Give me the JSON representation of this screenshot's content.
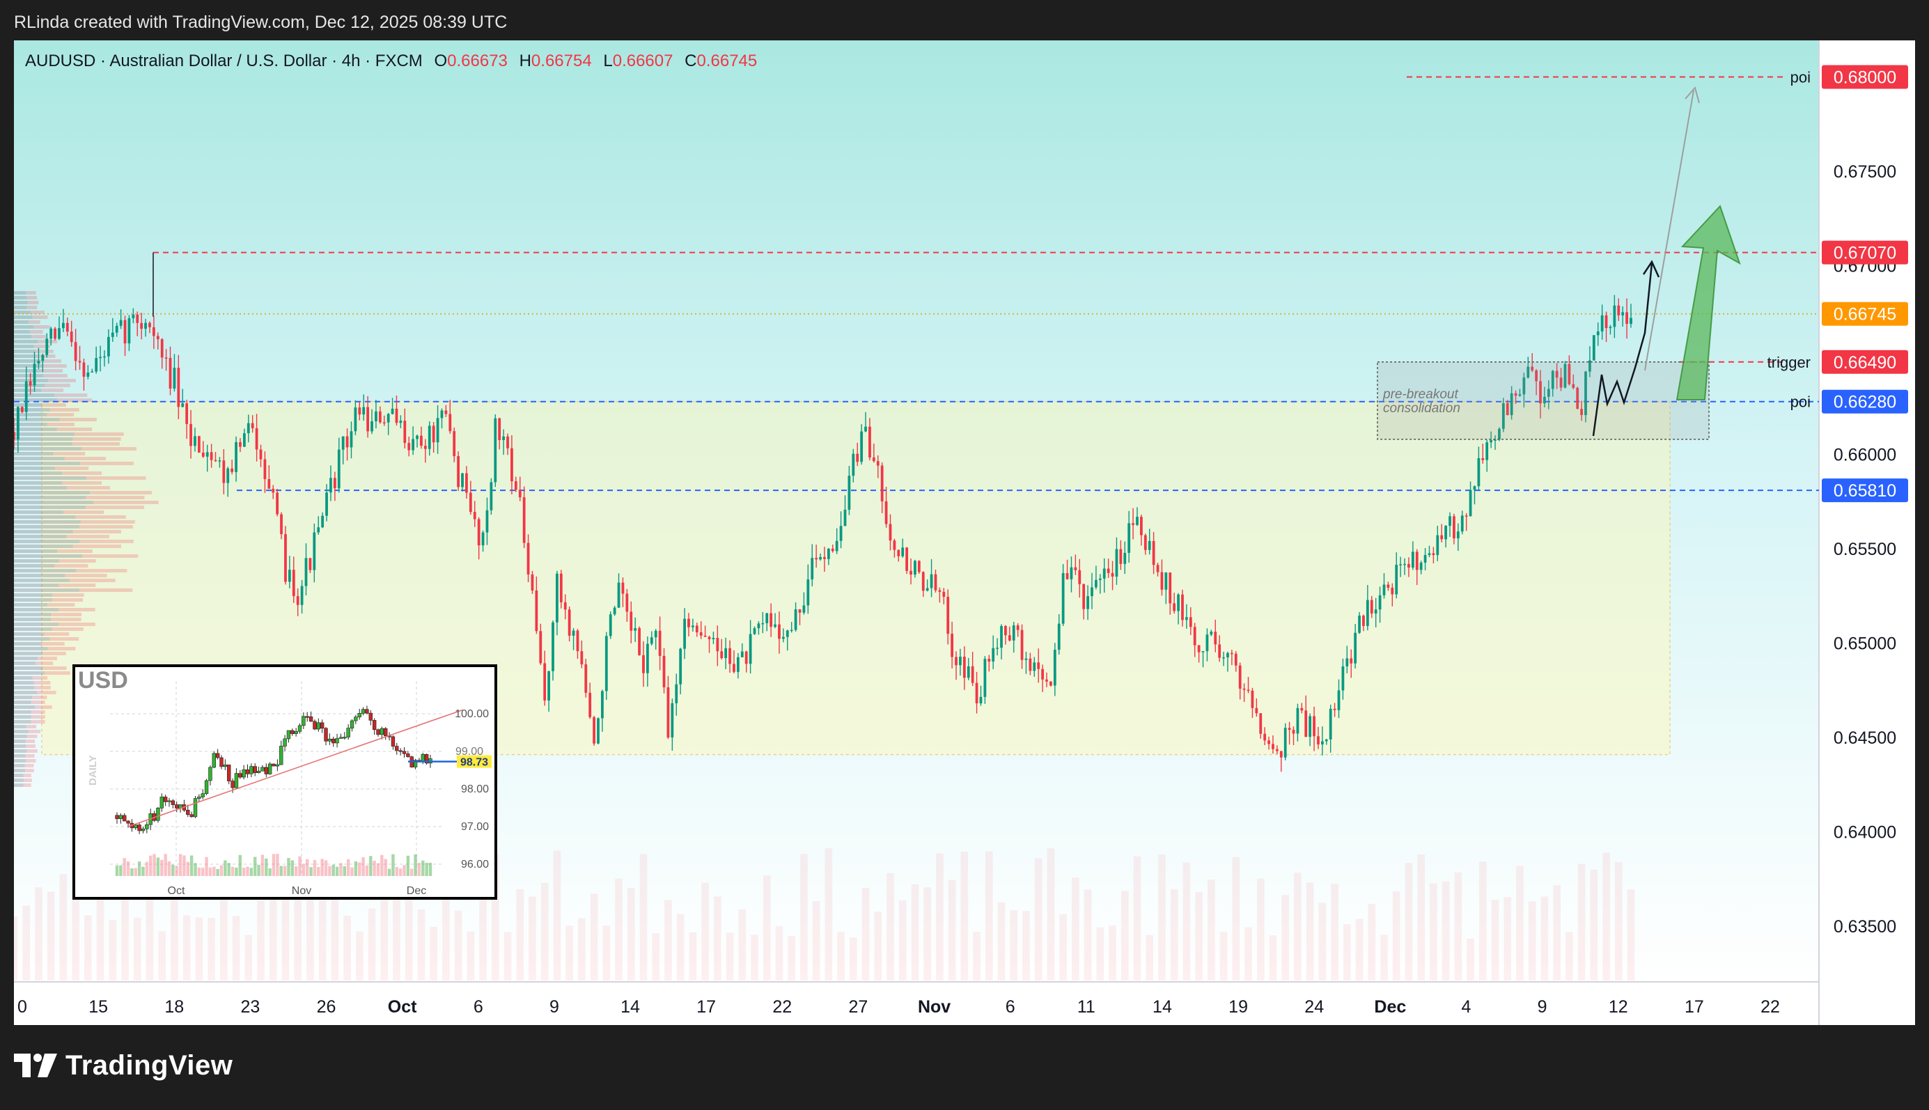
{
  "header": {
    "attribution": "RLinda created with TradingView.com, Dec 12, 2025 08:39 UTC"
  },
  "legend": {
    "symbol": "AUDUSD · Australian Dollar / U.S. Dollar · 4h · FXCM",
    "open_label": "O",
    "open": "0.66673",
    "high_label": "H",
    "high": "0.66754",
    "low_label": "L",
    "low": "0.66607",
    "close_label": "C",
    "close": "0.66745"
  },
  "footer": {
    "brand": "TradingView"
  },
  "colors": {
    "up": "#089981",
    "down": "#f23645",
    "red_level": "#f23645",
    "blue_level": "#2962ff",
    "orange_level": "#ff9800",
    "arrow_green": "#5cb85c"
  },
  "chart_data": [
    {
      "type": "candlestick",
      "title": "AUDUSD · Australian Dollar / U.S. Dollar · 4h · FXCM",
      "x_tick_labels": [
        "0",
        "15",
        "18",
        "23",
        "26",
        "Oct",
        "6",
        "9",
        "14",
        "17",
        "22",
        "27",
        "Nov",
        "6",
        "11",
        "14",
        "19",
        "24",
        "Dec",
        "4",
        "9",
        "12",
        "17",
        "22"
      ],
      "y_tick_labels": [
        "0.67500",
        "0.67000",
        "0.66000",
        "0.65500",
        "0.65000",
        "0.64500",
        "0.64000",
        "0.63500"
      ],
      "y_ticks": [
        0.675,
        0.67,
        0.66,
        0.655,
        0.65,
        0.645,
        0.64,
        0.635
      ],
      "ylim": [
        0.6325,
        0.6812
      ],
      "close_path": [
        [
          0,
          0.6612
        ],
        [
          2,
          0.665
        ],
        [
          4,
          0.6668
        ],
        [
          6,
          0.6642
        ],
        [
          8,
          0.666
        ],
        [
          10,
          0.6672
        ],
        [
          11,
          0.667
        ],
        [
          12,
          0.665
        ],
        [
          13,
          0.6638
        ],
        [
          14,
          0.661
        ],
        [
          16,
          0.6602
        ],
        [
          17,
          0.659
        ],
        [
          19,
          0.6612
        ],
        [
          20,
          0.6605
        ],
        [
          21,
          0.6572
        ],
        [
          22,
          0.654
        ],
        [
          23,
          0.6528
        ],
        [
          24,
          0.6545
        ],
        [
          25,
          0.6565
        ],
        [
          26,
          0.659
        ],
        [
          27,
          0.6608
        ],
        [
          28,
          0.6625
        ],
        [
          29,
          0.6615
        ],
        [
          30,
          0.662
        ],
        [
          32,
          0.661
        ],
        [
          33,
          0.6605
        ],
        [
          35,
          0.6618
        ],
        [
          36,
          0.659
        ],
        [
          37,
          0.6568
        ],
        [
          38,
          0.6555
        ],
        [
          39,
          0.6612
        ],
        [
          40,
          0.6605
        ],
        [
          41,
          0.657
        ],
        [
          42,
          0.652
        ],
        [
          43,
          0.647
        ],
        [
          44,
          0.653
        ],
        [
          46,
          0.649
        ],
        [
          47,
          0.6442
        ],
        [
          48,
          0.65
        ],
        [
          49,
          0.6525
        ],
        [
          50,
          0.6505
        ],
        [
          51,
          0.649
        ],
        [
          52,
          0.6508
        ],
        [
          53,
          0.645
        ],
        [
          54,
          0.65
        ],
        [
          55,
          0.6515
        ],
        [
          56,
          0.6505
        ],
        [
          57,
          0.6495
        ],
        [
          59,
          0.649
        ],
        [
          61,
          0.6512
        ],
        [
          63,
          0.6505
        ],
        [
          65,
          0.6545
        ],
        [
          67,
          0.656
        ],
        [
          68,
          0.6598
        ],
        [
          69,
          0.6608
        ],
        [
          70,
          0.6592
        ],
        [
          71,
          0.656
        ],
        [
          72,
          0.6545
        ],
        [
          73,
          0.6538
        ],
        [
          75,
          0.6525
        ],
        [
          76,
          0.65
        ],
        [
          77,
          0.6488
        ],
        [
          78,
          0.647
        ],
        [
          80,
          0.6512
        ],
        [
          81,
          0.6505
        ],
        [
          82,
          0.649
        ],
        [
          84,
          0.648
        ],
        [
          85,
          0.6532
        ],
        [
          86,
          0.6538
        ],
        [
          87,
          0.652
        ],
        [
          89,
          0.654
        ],
        [
          90,
          0.6555
        ],
        [
          91,
          0.6572
        ],
        [
          92,
          0.655
        ],
        [
          93,
          0.6535
        ],
        [
          95,
          0.651
        ],
        [
          96,
          0.6495
        ],
        [
          97,
          0.6505
        ],
        [
          99,
          0.6485
        ],
        [
          100,
          0.6475
        ],
        [
          101,
          0.646
        ],
        [
          102,
          0.644
        ],
        [
          103,
          0.645
        ],
        [
          104,
          0.6462
        ],
        [
          105,
          0.6455
        ],
        [
          106,
          0.645
        ],
        [
          107,
          0.6465
        ],
        [
          108,
          0.649
        ],
        [
          109,
          0.6508
        ],
        [
          110,
          0.6522
        ],
        [
          111,
          0.653
        ],
        [
          112,
          0.6535
        ],
        [
          113,
          0.654
        ],
        [
          114,
          0.655
        ],
        [
          115,
          0.6545
        ],
        [
          116,
          0.6558
        ],
        [
          117,
          0.6565
        ],
        [
          118,
          0.658
        ],
        [
          119,
          0.66
        ],
        [
          120,
          0.6612
        ],
        [
          121,
          0.6625
        ],
        [
          122,
          0.6635
        ],
        [
          123,
          0.6642
        ],
        [
          124,
          0.663
        ],
        [
          125,
          0.6645
        ],
        [
          126,
          0.6638
        ],
        [
          127,
          0.6625
        ],
        [
          128,
          0.666
        ],
        [
          129,
          0.667
        ],
        [
          130,
          0.6672
        ],
        [
          131,
          0.6674
        ]
      ],
      "levels": [
        {
          "label": "poi",
          "value": "0.68000",
          "price": 0.68,
          "style": "red-dashed"
        },
        {
          "label": "",
          "value": "0.67070",
          "price": 0.6707,
          "style": "red-dashed"
        },
        {
          "label": "",
          "value": "0.66745",
          "price": 0.66745,
          "style": "orange-dotted"
        },
        {
          "label": "trigger",
          "value": "0.66490",
          "price": 0.6649,
          "style": "red-dashed"
        },
        {
          "label": "poi",
          "value": "0.66280",
          "price": 0.6628,
          "style": "blue-dashed"
        },
        {
          "label": "",
          "value": "0.65810",
          "price": 0.6581,
          "style": "blue-dashed"
        }
      ],
      "range_zone": {
        "top": 0.6628,
        "bottom": 0.6441
      },
      "consolidation_box": {
        "top": 0.6649,
        "bottom": 0.6608,
        "label_line1": "pre-breakout",
        "label_line2": "consolidation"
      },
      "volume_profile": "left",
      "grid": false
    },
    {
      "type": "candlestick",
      "title": "USD",
      "side_label": "DAILY",
      "x_tick_labels": [
        "Oct",
        "Nov",
        "Dec"
      ],
      "y_tick_labels": [
        "100.00",
        "99.00",
        "98.00",
        "97.00",
        "96.00"
      ],
      "y_ticks": [
        100,
        99,
        98,
        97,
        96
      ],
      "ylim": [
        95.5,
        100.5
      ],
      "last_price": "98.73",
      "last_price_value": 98.73,
      "close_path": [
        [
          0,
          97.3
        ],
        [
          3,
          97.0
        ],
        [
          5,
          96.9
        ],
        [
          8,
          97.1
        ],
        [
          10,
          97.3
        ],
        [
          12,
          97.9
        ],
        [
          15,
          97.7
        ],
        [
          17,
          97.5
        ],
        [
          20,
          97.4
        ],
        [
          23,
          98.0
        ],
        [
          26,
          98.8
        ],
        [
          28,
          98.7
        ],
        [
          31,
          98.2
        ],
        [
          34,
          98.4
        ],
        [
          37,
          98.6
        ],
        [
          40,
          98.4
        ],
        [
          43,
          98.8
        ],
        [
          46,
          99.4
        ],
        [
          49,
          99.8
        ],
        [
          51,
          100.0
        ],
        [
          54,
          99.6
        ],
        [
          57,
          99.3
        ],
        [
          60,
          99.2
        ],
        [
          62,
          99.5
        ],
        [
          65,
          100.1
        ],
        [
          68,
          99.9
        ],
        [
          70,
          99.6
        ],
        [
          72,
          99.4
        ],
        [
          74,
          99.2
        ],
        [
          76,
          98.9
        ],
        [
          79,
          98.7
        ],
        [
          82,
          98.9
        ],
        [
          84,
          98.73
        ]
      ],
      "trendline": {
        "from": [
          3,
          97.0
        ],
        "to": [
          89,
          100.1
        ]
      },
      "volume": true
    }
  ]
}
